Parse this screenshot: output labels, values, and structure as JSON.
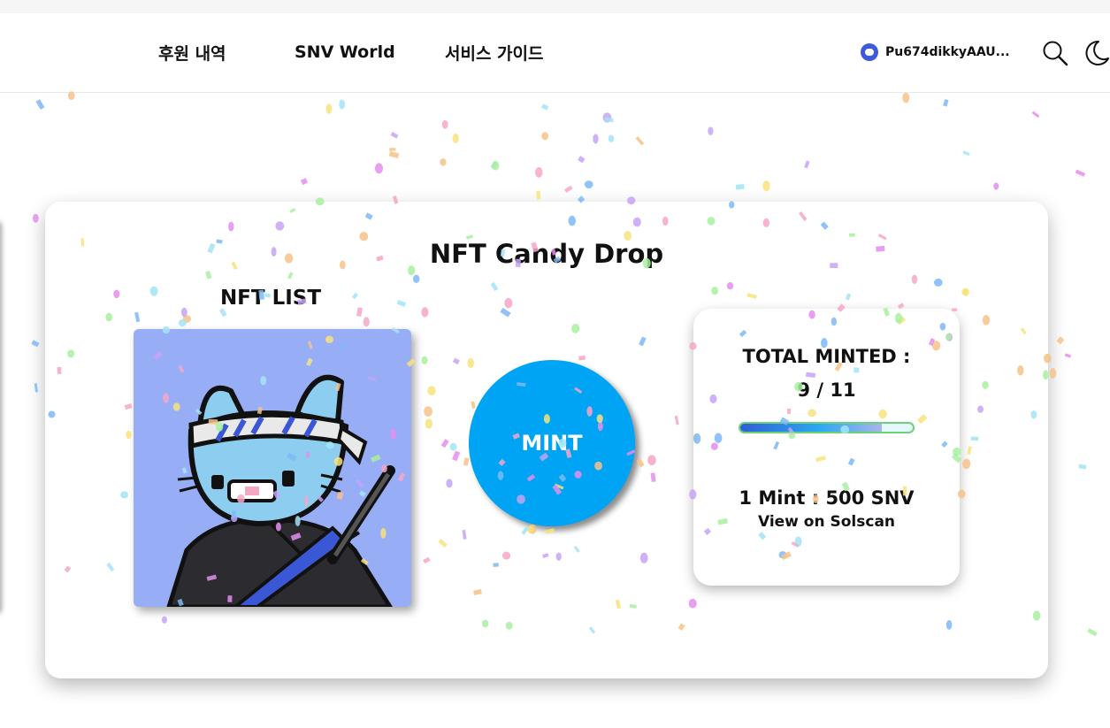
{
  "nav": {
    "items": [
      {
        "label": "후원 내역"
      },
      {
        "label": "SNV World"
      },
      {
        "label": "서비스 가이드"
      }
    ],
    "wallet_address": "Pu674dikkyAAU...",
    "search_icon": "search-icon",
    "theme_icon": "moon-icon"
  },
  "candy_drop": {
    "title": "NFT Candy Drop",
    "list_title": "NFT LIST",
    "mint_label": "MINT",
    "total_minted_label": "TOTAL MINTED :",
    "minted_count": "9 / 11",
    "minted_progress": 0.82,
    "price": "1 Mint : 500 SNV",
    "solscan_link": "View on Solscan"
  },
  "colors": {
    "mint_button": "#00a4f5",
    "nft_background": "#97aef7",
    "progress_start": "#2f5fd6",
    "progress_end": "#2ba7f0"
  }
}
